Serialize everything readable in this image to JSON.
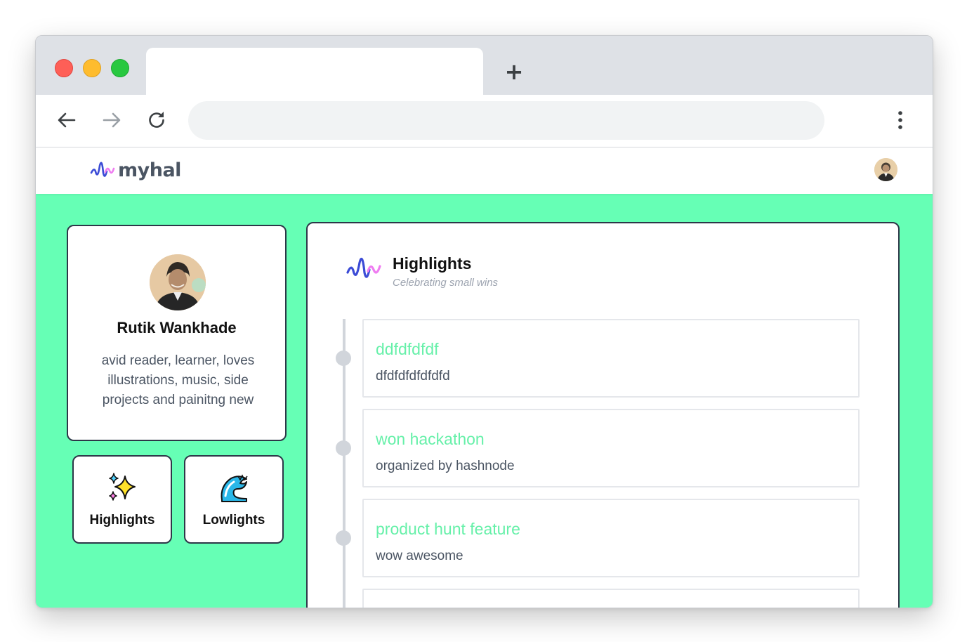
{
  "browser": {
    "tab_title": "",
    "new_tab_label": "+",
    "url": "",
    "icons": [
      "back-arrow-icon",
      "forward-arrow-icon",
      "reload-icon",
      "more-vertical-icon"
    ]
  },
  "app": {
    "brand": "myhal",
    "logo_icon": "wave-logo-icon",
    "accent_color": "#66ffb5",
    "entry_title_color": "#66f0a9"
  },
  "profile": {
    "name": "Rutik Wankhade",
    "bio": "avid reader, learner, loves illustrations, music, side projects and painitng new"
  },
  "nav_cards": [
    {
      "label": "Highlights",
      "icon": "sparkles-icon"
    },
    {
      "label": "Lowlights",
      "icon": "wave-icon"
    }
  ],
  "main": {
    "title": "Highlights",
    "subtitle": "Celebrating small wins",
    "entries": [
      {
        "title": "ddfdfdfdf",
        "desc": "dfdfdfdfdfdfd"
      },
      {
        "title": "won hackathon",
        "desc": "organized by hashnode"
      },
      {
        "title": "product hunt feature",
        "desc": "wow awesome"
      },
      {
        "title": "",
        "desc": ""
      }
    ]
  }
}
